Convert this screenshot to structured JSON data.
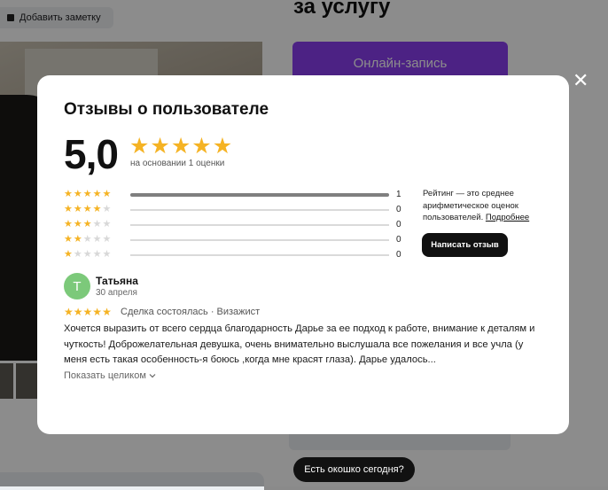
{
  "page": {
    "add_note_label": "Добавить заметку",
    "title_fragment": "за услугу",
    "online_booking_label": "Онлайн-запись",
    "window_today_label": "Есть окошко сегодня?",
    "close_glyph": "✕"
  },
  "modal": {
    "title": "Отзывы о пользователе",
    "rating": "5,0",
    "rating_stars": 5,
    "based_on": "на основании 1 оценки",
    "distribution": [
      {
        "stars": 5,
        "count": "1",
        "fraction": 1
      },
      {
        "stars": 4,
        "count": "0",
        "fraction": 0
      },
      {
        "stars": 3,
        "count": "0",
        "fraction": 0
      },
      {
        "stars": 2,
        "count": "0",
        "fraction": 0
      },
      {
        "stars": 1,
        "count": "0",
        "fraction": 0
      }
    ],
    "info_text": "Рейтинг — это среднее арифметическое оценок пользователей.",
    "info_link": "Подробнее",
    "write_review_label": "Написать отзыв"
  },
  "review": {
    "avatar_letter": "Т",
    "author": "Татьяна",
    "date": "30 апреля",
    "stars": 5,
    "meta": "Сделка состоялась · Визажист",
    "text": "Хочется выразить от всего сердца благодарность Дарье за ее подход к работе, внимание к деталям и чуткость! Доброжелательная девушка, очень внимательно выслушала все пожелания и все учла (у меня есть такая особенность-я боюсь ,когда мне красят глаза). Дарье удалось...",
    "show_full_label": "Показать целиком",
    "show_full_icon": "chevron-down-icon"
  },
  "colors": {
    "accent_purple": "#8b3ff0",
    "star": "#f5b324",
    "avatar": "#7cc97a"
  }
}
